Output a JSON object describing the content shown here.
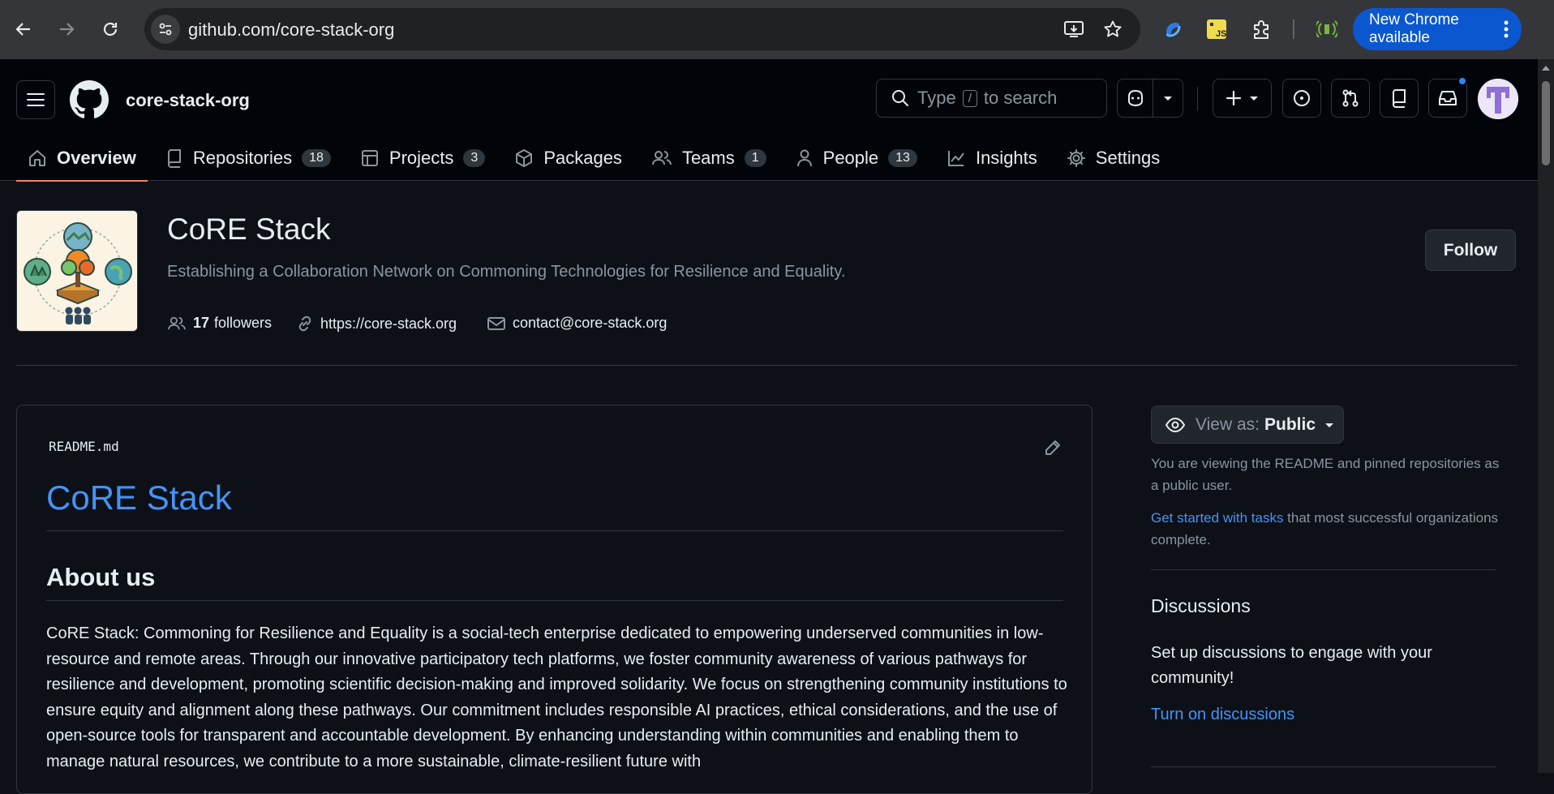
{
  "browser": {
    "url": "github.com/core-stack-org",
    "update_label": "New Chrome available"
  },
  "header": {
    "org_name": "core-stack-org",
    "search_prefix": "Type",
    "search_key": "/",
    "search_suffix": "to search"
  },
  "tabs": [
    {
      "label": "Overview",
      "count": null,
      "icon": "home-icon"
    },
    {
      "label": "Repositories",
      "count": "18",
      "icon": "repo-icon"
    },
    {
      "label": "Projects",
      "count": "3",
      "icon": "table-icon"
    },
    {
      "label": "Packages",
      "count": null,
      "icon": "package-icon"
    },
    {
      "label": "Teams",
      "count": "1",
      "icon": "people-icon"
    },
    {
      "label": "People",
      "count": "13",
      "icon": "person-icon"
    },
    {
      "label": "Insights",
      "count": null,
      "icon": "graph-icon"
    },
    {
      "label": "Settings",
      "count": null,
      "icon": "gear-icon"
    }
  ],
  "org": {
    "title": "CoRE Stack",
    "description": "Establishing a Collaboration Network on Commoning Technologies for Resilience and Equality.",
    "followers_count": "17",
    "followers_label": "followers",
    "website": "https://core-stack.org",
    "email": "contact@core-stack.org",
    "follow_label": "Follow"
  },
  "readme": {
    "filename": "README.md",
    "h1": "CoRE Stack",
    "h2": "About us",
    "paragraph": "CoRE Stack: Commoning for Resilience and Equality is a social-tech enterprise dedicated to empowering underserved communities in low-resource and remote areas. Through our innovative participatory tech platforms, we foster community awareness of various pathways for resilience and development, promoting scientific decision-making and improved solidarity. We focus on strengthening community institutions to ensure equity and alignment along these pathways. Our commitment includes responsible AI practices, ethical considerations, and the use of open-source tools for transparent and accountable development. By enhancing understanding within communities and enabling them to manage natural resources, we contribute to a more sustainable, climate-resilient future with"
  },
  "sidebar": {
    "view_as_label": "View as:",
    "view_as_value": "Public",
    "view_note": "You are viewing the README and pinned repositories as a public user.",
    "tasks_link": "Get started with tasks",
    "tasks_suffix": " that most successful organizations complete.",
    "discussions_heading": "Discussions",
    "discussions_text": "Set up discussions to engage with your community!",
    "discussions_link": "Turn on discussions"
  },
  "colors": {
    "accent_link": "#4493f8",
    "active_tab_underline": "#f78166",
    "chrome_update": "#0b57d0"
  }
}
